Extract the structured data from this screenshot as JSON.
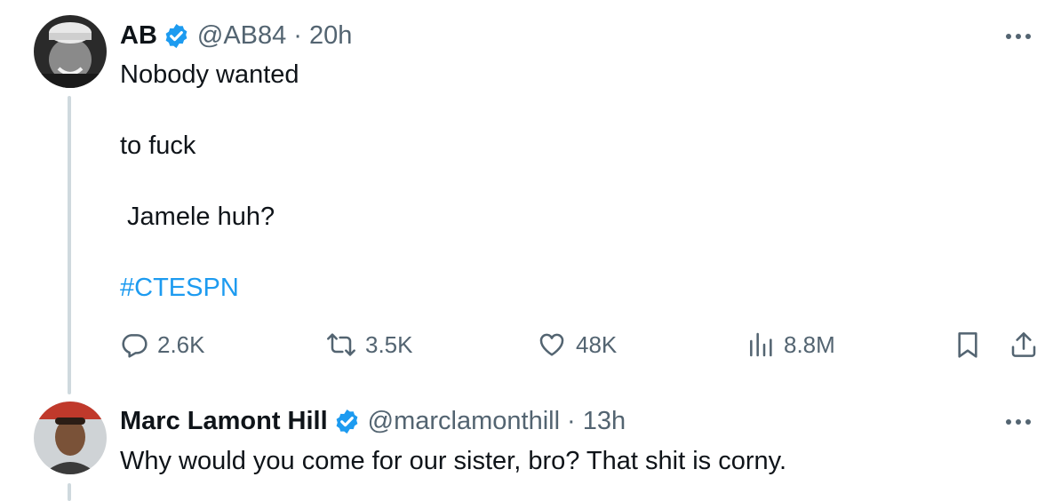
{
  "tweets": [
    {
      "author_name": "AB",
      "handle": "@AB84",
      "separator": "·",
      "time": "20h",
      "text_lines": [
        "Nobody wanted",
        "to fuck",
        " Jamele huh?"
      ],
      "hashtag": "#CTESPN",
      "stats": {
        "replies": "2.6K",
        "retweets": "3.5K",
        "likes": "48K",
        "views": "8.8M"
      }
    },
    {
      "author_name": "Marc Lamont Hill",
      "handle": "@marclamonthill",
      "separator": "·",
      "time": "13h",
      "text": "Why would you come for our sister, bro? That shit is corny."
    }
  ],
  "icons": {
    "verified": "verified-badge-icon",
    "more": "more-dots-icon",
    "reply": "reply-icon",
    "retweet": "retweet-icon",
    "like": "heart-icon",
    "views": "views-icon",
    "bookmark": "bookmark-icon",
    "share": "share-icon"
  },
  "colors": {
    "text": "#0f1419",
    "secondary": "#536471",
    "accent": "#1d9bf0",
    "thread_line": "#cfd9de"
  }
}
